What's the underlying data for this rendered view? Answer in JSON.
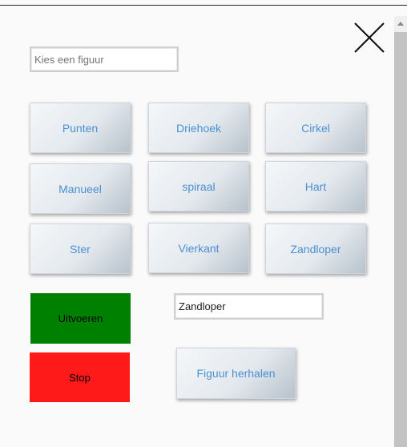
{
  "header": {
    "close_icon": "close-icon"
  },
  "shape_select": {
    "placeholder": "Kies een figuur"
  },
  "shape_buttons": [
    {
      "label": "Punten"
    },
    {
      "label": "Driehoek"
    },
    {
      "label": "Cirkel"
    },
    {
      "label": "Manueel"
    },
    {
      "label": "spiraal"
    },
    {
      "label": "Hart"
    },
    {
      "label": "Ster"
    },
    {
      "label": "Vierkant"
    },
    {
      "label": "Zandloper"
    }
  ],
  "actions": {
    "run_label": "Uitvoeren",
    "stop_label": "Stop",
    "repeat_label": "Figuur herhalen"
  },
  "selected_shape": {
    "value": "Zandloper"
  },
  "colors": {
    "run": "#008000",
    "stop": "#ff1a1a",
    "button_text": "#4a90d2"
  },
  "scrollbar": {
    "up_icon": "chevron-up-icon"
  }
}
